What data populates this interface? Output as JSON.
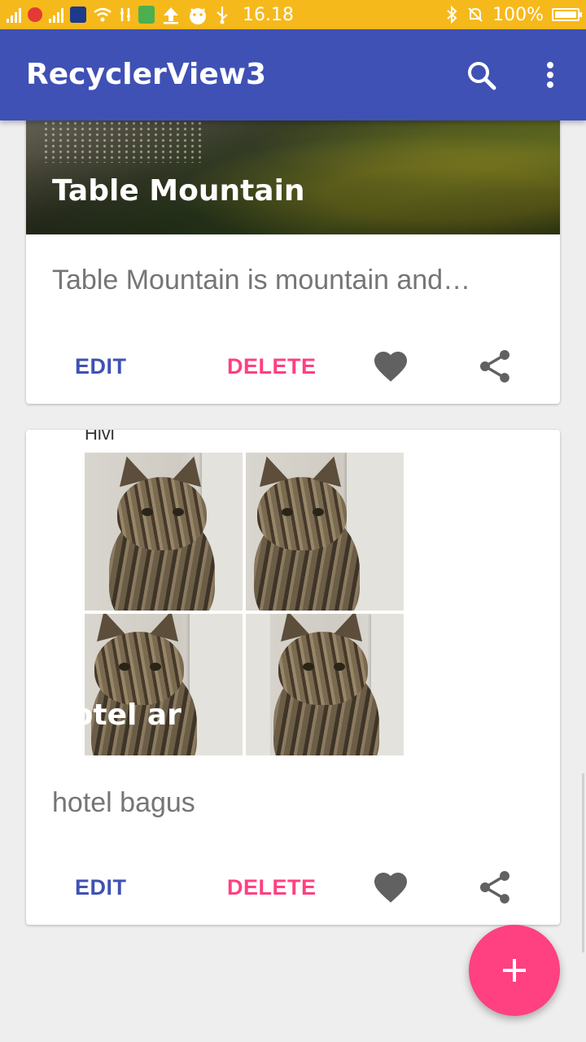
{
  "status_bar": {
    "time": "16.18",
    "battery": "100%"
  },
  "app_bar": {
    "title": "RecyclerView3",
    "icons": [
      "search-icon",
      "more-vert-icon"
    ]
  },
  "cards": [
    {
      "title": "Table Mountain",
      "description": "Table Mountain is mountain and…",
      "edit_label": "EDIT",
      "delete_label": "DELETE",
      "icons": [
        "favorite-icon",
        "share-icon"
      ]
    },
    {
      "title": "hotel ar",
      "image_caption": "Hivi",
      "description": "hotel bagus",
      "edit_label": "EDIT",
      "delete_label": "DELETE",
      "icons": [
        "favorite-icon",
        "share-icon"
      ]
    }
  ],
  "fab": {
    "icon": "add-icon"
  },
  "colors": {
    "status_bar": "#f6b91c",
    "primary": "#3f51b5",
    "accent": "#ff4081",
    "background": "#eeeeee",
    "secondary_text": "#757575",
    "icon_gray": "#616161"
  }
}
